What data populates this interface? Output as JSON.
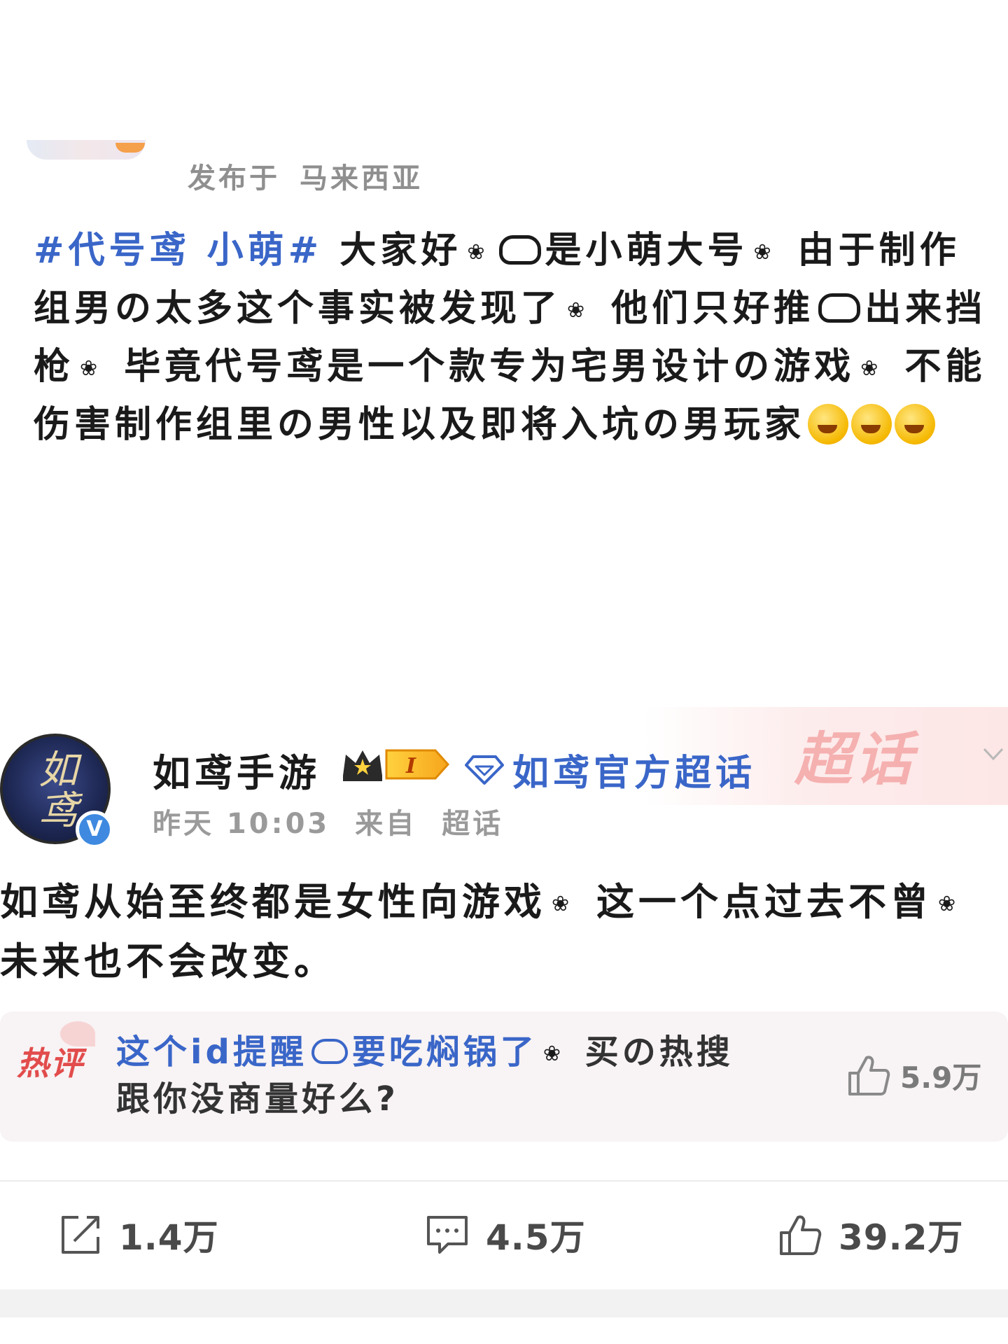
{
  "post1": {
    "meta": {
      "prefix": "发布于",
      "location": "马来西亚"
    },
    "body": {
      "topic": "#代号鸢 小萌#",
      "line1_a": " 大家好",
      "line1_b": "是小萌大号",
      "line1_c": " 由于制作组男の太多这个事实被发现了",
      "line2_a": " 他们只好推",
      "line2_b": "出来挡枪",
      "line3_a": " 毕竟代号鸢是一个款专为宅男设计の游戏",
      "line3_b": " 不能伤害制作组里の男性以及即将入坑の男玩家"
    }
  },
  "post2": {
    "supertopic_watermark": "超话",
    "user": {
      "name": "如鸢手游",
      "level": "I",
      "avatar_text": "如鸢",
      "verified_mark": "V"
    },
    "supertopic_label": "如鸢官方超话",
    "meta": {
      "time": "昨天 10:03",
      "from_prefix": "来自",
      "source": "超话"
    },
    "body": {
      "line1_a": "如鸢从始至终都是女性向游戏",
      "line1_b": " 这一个点过去不曾",
      "line2": "未来也不会改变。"
    },
    "hot_comment": {
      "tag": "热评",
      "user": "这个id提醒",
      "user_tail": "要吃焖锅了",
      "text_a": " 买の热搜",
      "text_b": "跟你没商量好么?",
      "likes": "5.9万"
    },
    "actions": {
      "repost_count": "1.4万",
      "comment_count": "4.5万",
      "like_count": "39.2万"
    }
  },
  "colors": {
    "accent_blue": "#3a66c8",
    "hot_red": "#e24c4c",
    "meta_gray": "#9a9a9a",
    "comment_bg": "#f8f3f4"
  }
}
